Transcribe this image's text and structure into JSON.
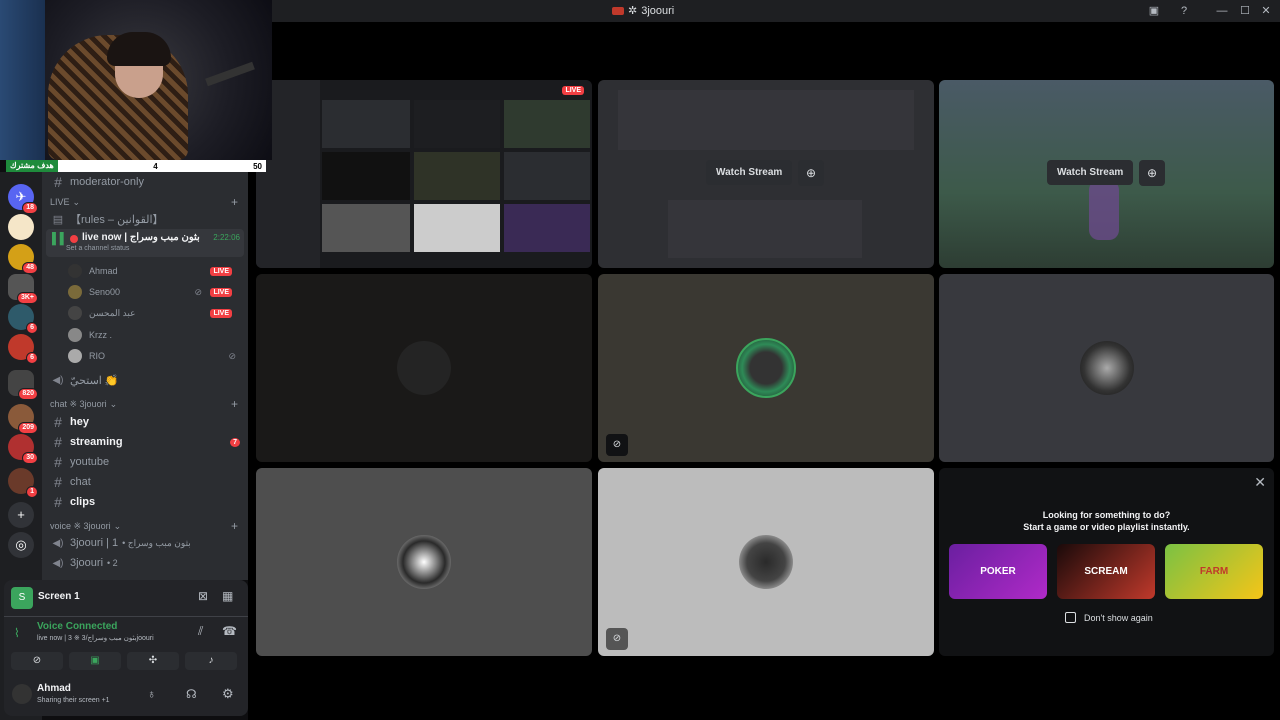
{
  "window": {
    "title": "3joouri"
  },
  "goal_bar": {
    "label": "هدف مشترك",
    "current": "4",
    "target": "50"
  },
  "servers": [
    {
      "badge": "18"
    },
    {
      "badge": ""
    },
    {
      "badge": "48"
    },
    {
      "badge": "3K+"
    },
    {
      "badge": "6"
    },
    {
      "badge": "6"
    },
    {
      "badge": "820"
    },
    {
      "badge": "209"
    },
    {
      "badge": "30"
    },
    {
      "badge": "1"
    }
  ],
  "channels": {
    "moderator_only": "moderator-only",
    "live_category": "LIVE",
    "rules": "【rules – القوانين】",
    "live_now": {
      "name": "live now | بثون مبب وسراج",
      "timer": "2:22:06",
      "status": "Set a channel status"
    },
    "voice_users": [
      {
        "name": "Ahmad",
        "live": "LIVE"
      },
      {
        "name": "Seno00",
        "live": "LIVE"
      },
      {
        "name": "عبد المحسن",
        "live": "LIVE"
      },
      {
        "name": "Krzz .",
        "live": ""
      },
      {
        "name": "RIO",
        "live": ""
      }
    ],
    "istahi": "استحيّ 👏",
    "chat_category": "chat ※ 3jouori",
    "text_channels": [
      {
        "name": "hey",
        "bold": true,
        "badge": ""
      },
      {
        "name": "streaming",
        "bold": true,
        "badge": "7"
      },
      {
        "name": "youtube",
        "bold": false,
        "badge": ""
      },
      {
        "name": "chat",
        "bold": false,
        "badge": ""
      },
      {
        "name": "clips",
        "bold": true,
        "badge": ""
      }
    ],
    "voice_category": "voice ※ 3jouori",
    "voice_channels": [
      {
        "name": "3joouri | 1",
        "suffix": "• بثون مبب وسراج"
      },
      {
        "name": "3joouri",
        "suffix": "• 2"
      }
    ]
  },
  "panel": {
    "screen_label": "Screen 1",
    "voice_connected": "Voice Connected",
    "voice_sub": "live now | 3 ※ بثون مبب وسراج/3joouri"
  },
  "user": {
    "name": "Ahmad",
    "status": "Sharing their screen +1"
  },
  "stage": {
    "live_badge": "LIVE",
    "watch_stream": "Watch Stream",
    "promo": {
      "line1": "Looking for something to do?",
      "line2": "Start a game or video playlist instantly.",
      "dont_show": "Don't show again",
      "games": [
        "POKER",
        "SCREAM",
        "FARM"
      ]
    }
  }
}
